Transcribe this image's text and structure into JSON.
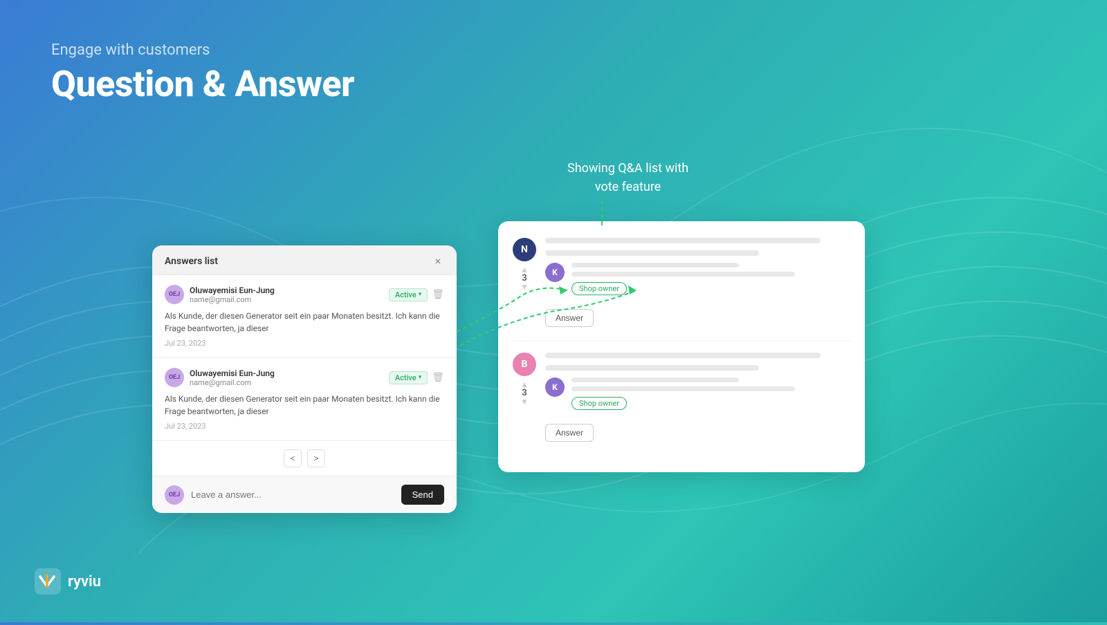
{
  "background": {
    "gradient_start": "#3a7bd5",
    "gradient_end": "#1a9e9e"
  },
  "header": {
    "subtitle": "Engage with customers",
    "title": "Question & Answer"
  },
  "annotation": {
    "line1": "Showing Q&A list with",
    "line2": "vote feature"
  },
  "answers_card": {
    "title": "Answers list",
    "close_label": "×",
    "items": [
      {
        "avatar_initials": "OEJ",
        "user_name": "Oluwayemisi Eun-Jung",
        "user_email": "name@gmail.com",
        "status": "Active",
        "text": "Als Kunde, der diesen Generator seit ein paar Monaten besitzt. Ich kann die Frage beantworten, ja dieser",
        "date": "Jul 23, 2023"
      },
      {
        "avatar_initials": "OEJ",
        "user_name": "Oluwayemisi Eun-Jung",
        "user_email": "name@gmail.com",
        "status": "Active",
        "text": "Als Kunde, der diesen Generator seit ein paar Monaten besitzt. Ich kann die Frage beantworten, ja dieser",
        "date": "Jul 23, 2023"
      }
    ],
    "pagination": {
      "prev": "<",
      "next": ">"
    },
    "input_placeholder": "Leave a answer...",
    "send_label": "Send"
  },
  "qa_card": {
    "items": [
      {
        "avatar_letter": "N",
        "avatar_class": "navy",
        "vote_up": "▲",
        "vote_count": "3",
        "vote_down": "▼",
        "answer_avatar": "K",
        "shop_owner_label": "Shop owner",
        "answer_button": "Answer"
      },
      {
        "avatar_letter": "B",
        "avatar_class": "pink",
        "vote_up": "▲",
        "vote_count": "3",
        "vote_down": "▼",
        "answer_avatar": "K",
        "shop_owner_label": "Shop owner",
        "answer_button": "Answer"
      }
    ]
  },
  "logo": {
    "text": "ryviu"
  }
}
